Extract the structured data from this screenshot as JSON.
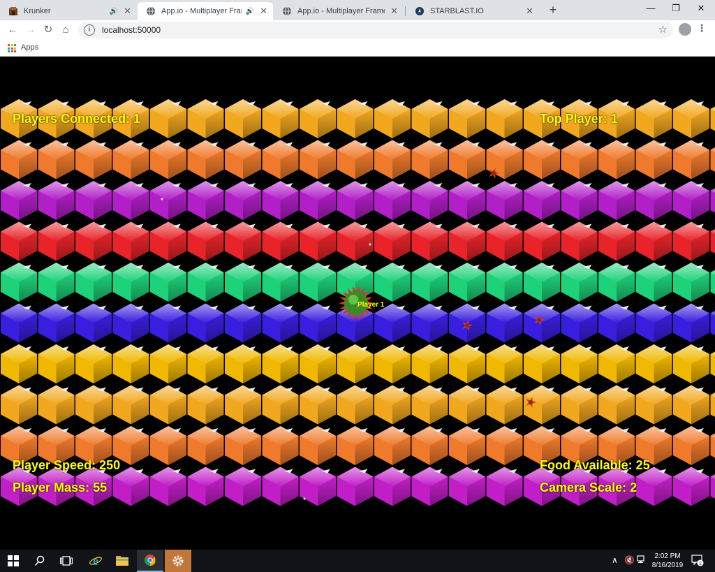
{
  "browser": {
    "tabs": [
      {
        "title": "Krunker",
        "audio": true,
        "active": false
      },
      {
        "title": "App.io - Multiplayer Framew",
        "audio": true,
        "active": true
      },
      {
        "title": "App.io - Multiplayer Framework",
        "audio": false,
        "active": false
      },
      {
        "title": "STARBLAST.IO",
        "audio": false,
        "active": false
      }
    ],
    "address": "localhost:50000",
    "bookmarks": {
      "apps_label": "Apps"
    }
  },
  "game": {
    "hud": {
      "players_connected": "Players Connected: 1",
      "top_player": "Top Player: 1",
      "player_speed": "Player Speed: 250",
      "player_mass": "Player Mass: 55",
      "food_available": "Food Available: 25",
      "camera_scale": "Camera Scale: 2"
    },
    "player": {
      "label": "Player 1"
    },
    "colors": {
      "hud_text": "#ffff00",
      "background": "#000000",
      "row_palette": [
        "#f2a81e",
        "#f07a2c",
        "#b21ec8",
        "#e8242a",
        "#1ed27a",
        "#3a1ee0",
        "#f0b800",
        "#f2a81e",
        "#f07a2c",
        "#c21ec8"
      ]
    }
  },
  "taskbar": {
    "time": "2:02 PM",
    "date": "8/16/2019",
    "notifications": "2"
  }
}
